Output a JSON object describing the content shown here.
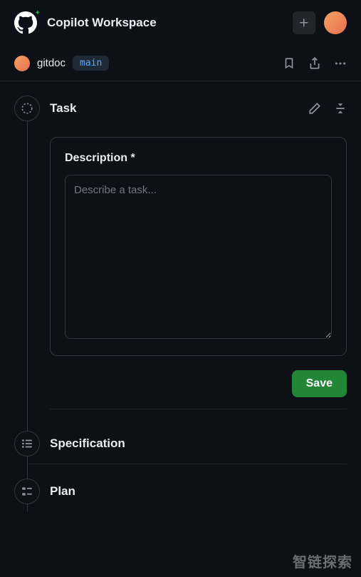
{
  "header": {
    "title": "Copilot Workspace"
  },
  "toolbar": {
    "repo": "gitdoc",
    "branch": "main"
  },
  "sections": {
    "task": {
      "title": "Task",
      "description_label": "Description *",
      "placeholder": "Describe a task...",
      "value": "",
      "save_label": "Save"
    },
    "specification": {
      "title": "Specification"
    },
    "plan": {
      "title": "Plan"
    }
  },
  "watermark": "智链探索"
}
